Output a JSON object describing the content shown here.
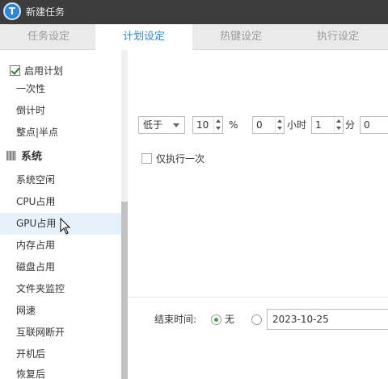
{
  "window": {
    "title": "新建任务",
    "logo_letter": "T"
  },
  "tabs": [
    {
      "label": "任务设定",
      "active": false
    },
    {
      "label": "计划设定",
      "active": true
    },
    {
      "label": "热键设定",
      "active": false
    },
    {
      "label": "执行设定",
      "active": false
    }
  ],
  "sidebar": {
    "enable_plan": {
      "label": "启用计划",
      "checked": true
    },
    "items_top": [
      "一次性",
      "倒计时",
      "整点|半点"
    ],
    "group": "系统",
    "items": [
      "系统空闲",
      "CPU占用",
      "GPU占用",
      "内存占用",
      "磁盘占用",
      "文件夹监控",
      "网速",
      "互联网断开",
      "开机后",
      "恢复后"
    ],
    "hovered_item": "GPU占用"
  },
  "condition": {
    "comparator": "低于",
    "threshold": "10",
    "threshold_unit": "%",
    "hours": "0",
    "hours_unit": "小时",
    "minutes": "1",
    "minutes_unit": "分",
    "seconds": "0"
  },
  "run_once": {
    "label": "仅执行一次",
    "checked": false
  },
  "end_time": {
    "label": "结束时间:",
    "none_label": "无",
    "none_selected": true,
    "date_value": "2023-10-25"
  },
  "colors": {
    "accent": "#2f86d6",
    "titlebar": "#3c3c3c",
    "radio_selected": "#43a047"
  }
}
